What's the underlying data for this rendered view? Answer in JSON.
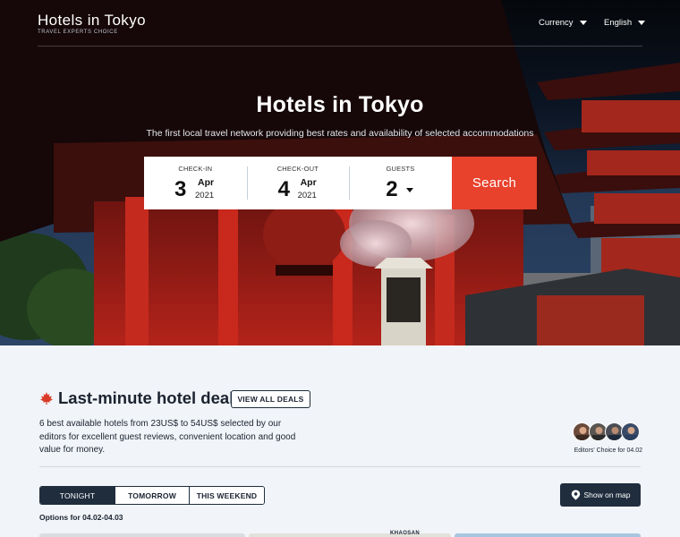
{
  "header": {
    "logo_title": "Hotels in Tokyo",
    "logo_subtitle": "TRAVEL EXPERTS CHOICE",
    "currency_label": "Currency",
    "language_label": "English"
  },
  "hero": {
    "title": "Hotels in Tokyo",
    "subtitle": "The first local travel network providing best rates and availability of selected accommodations"
  },
  "search": {
    "checkin": {
      "label": "CHECK-IN",
      "day": "3",
      "month": "Apr",
      "year": "2021"
    },
    "checkout": {
      "label": "CHECK-OUT",
      "day": "4",
      "month": "Apr",
      "year": "2021"
    },
    "guests": {
      "label": "GUESTS",
      "value": "2"
    },
    "button_label": "Search",
    "accent_color": "#e8412c"
  },
  "deals": {
    "title": "Last-minute hotel deals",
    "view_all_label": "VIEW ALL DEALS",
    "description": "6 best available hotels from 23US$ to 54US$ selected by our editors for excellent guest reviews, convenient location and good value for money.",
    "editors_label": "Editors' Choice for 04.02",
    "tabs": [
      {
        "label": "TONIGHT",
        "active": true
      },
      {
        "label": "TOMORROW",
        "active": false
      },
      {
        "label": "THIS WEEKEND",
        "active": false
      }
    ],
    "options_label": "Options for 04.02-04.03",
    "map_button_label": "Show on map",
    "card_peek_label": "KHAOSAN"
  },
  "icons": {
    "deals_icon": "maple-leaf-icon",
    "map_icon": "map-pin-icon"
  }
}
